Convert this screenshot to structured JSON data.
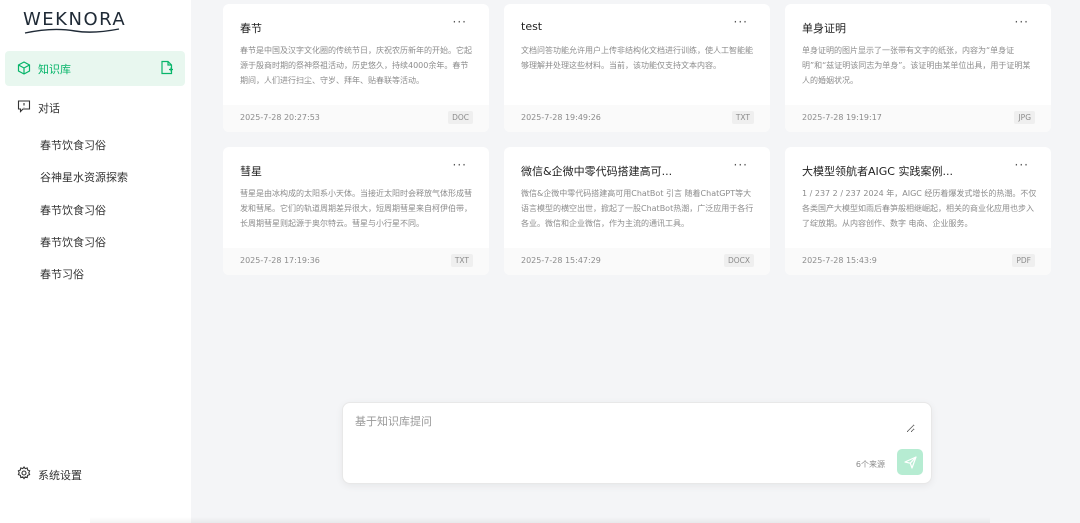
{
  "app": {
    "logo": "WEKNORA"
  },
  "sidebar": {
    "knowledge_base": {
      "label": "知识库"
    },
    "chat": {
      "label": "对话"
    },
    "conversations": [
      "春节饮食习俗",
      "谷神星水资源探索",
      "春节饮食习俗",
      "春节饮食习俗",
      "春节习俗"
    ],
    "settings": {
      "label": "系统设置"
    }
  },
  "cards": [
    {
      "title": "春节",
      "more": "···",
      "desc": "春节是中国及汉字文化圈的传统节日，庆祝农历新年的开始。它起源于殷商时期的祭神祭祖活动，历史悠久，持续4000余年。春节期间，人们进行扫尘、守岁、拜年、贴春联等活动。",
      "date": "2025-7-28 20:27:53",
      "type": "DOC"
    },
    {
      "title": "test",
      "more": "···",
      "desc": "文档问答功能允许用户上传非结构化文档进行训练，使人工智能能够理解并处理这些材料。当前，该功能仅支持文本内容。",
      "date": "2025-7-28 19:49:26",
      "type": "TXT"
    },
    {
      "title": "单身证明",
      "more": "···",
      "desc": "单身证明的图片显示了一张带有文字的纸张，内容为“单身证明”和“兹证明该同志为单身”。该证明由某单位出具，用于证明某人的婚姻状况。",
      "date": "2025-7-28 19:19:17",
      "type": "JPG"
    },
    {
      "title": "彗星",
      "more": "···",
      "desc": "彗星是由冰构成的太阳系小天体。当接近太阳时会释放气体形成彗发和彗尾。它们的轨道周期差异很大，短周期彗星来自柯伊伯带，长周期彗星则起源于奥尔特云。彗星与小行星不同。",
      "date": "2025-7-28 17:19:36",
      "type": "TXT"
    },
    {
      "title": "微信&企微中零代码搭建高可...",
      "more": "···",
      "desc": "微信&企微中零代码搭建高可用ChatBot 引言 随着ChatGPT等大语言模型的横空出世，掀起了一股ChatBot热潮，广泛应用于各行各业。微信和企业微信，作为主流的通讯工具。",
      "date": "2025-7-28 15:47:29",
      "type": "DOCX"
    },
    {
      "title": "大模型领航者AIGC 实践案例...",
      "more": "···",
      "desc": "1 / 237 2 / 237 2024 年，AIGC 经历着爆发式增长的热潮。不仅 各类国产大模型如雨后春笋般相继崛起，相关的商业化应用也步入了绽放期。从内容创作、数字 电商、企业服务。",
      "date": "2025-7-28 15:43:9",
      "type": "PDF"
    }
  ],
  "ask": {
    "placeholder": "基于知识库提问",
    "sources": "6个来源"
  },
  "colors": {
    "accent": "#07b56a",
    "accent_light": "#e8f7ef",
    "send_bg": "#b6ecd2"
  }
}
